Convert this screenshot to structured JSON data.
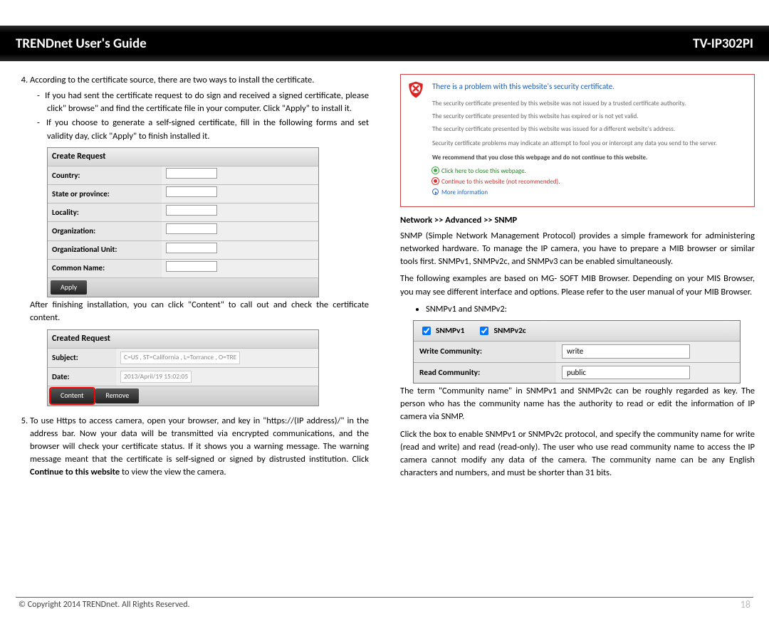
{
  "header": {
    "left": "TRENDnet User's Guide",
    "right": "TV-IP302PI"
  },
  "left": {
    "li4_intro": "According to the certificate source, there are two ways to install the certificate.",
    "dash1": "If you had sent the certificate request to do sign and received a signed certificate, please click\" browse\" and find the certificate file in your computer. Click \"Apply\" to install it.",
    "dash2": "If you choose to generate a self-signed certificate, fill in the following forms and set validity day, click \"Apply\" to finish installed it.",
    "after_install": "After finishing installation, you can click \"Content\" to call out and check the certificate content.",
    "li5_p1": "To use Https to access camera, open your browser, and key in \"https://(IP address)/\" in the address bar. Now your data will be transmitted via encrypted communications, and the browser will check your certificate status. If it shows you a warning message.  The warning message meant that the certificate is self-signed or signed by distrusted institution.  Click ",
    "li5_bold": "Continue to this website",
    "li5_p2": " to view the view the camera.",
    "create_request": {
      "heading": "Create Request",
      "rows": [
        "Country:",
        "State or province:",
        "Locality:",
        "Organization:",
        "Organizational Unit:",
        "Common Name:"
      ],
      "apply": "Apply"
    },
    "created_request": {
      "heading": "Created Request",
      "subject_label": "Subject:",
      "subject_value": "C=US , ST=California , L=Torrance , O=TRE",
      "date_label": "Date:",
      "date_value": "2013/April/19 15:02:05",
      "content": "Content",
      "remove": "Remove"
    }
  },
  "sec": {
    "title": "There is a problem with this website's security certificate.",
    "t1": "The security certificate presented by this website was not issued by a trusted certificate authority.",
    "t2": "The security certificate presented by this website has expired or is not yet valid.",
    "t3": "The security certificate presented by this website was issued for a different website's address.",
    "t4": "Security certificate problems may indicate an attempt to fool you or intercept any data you send to the server.",
    "strong": "We recommend that you close this webpage and do not continue to this website.",
    "link1": "Click here to close this webpage.",
    "link2": "Continue to this website (not recommended).",
    "link3": "More information"
  },
  "right": {
    "heading": "Network >> Advanced >> SNMP",
    "p1": "SNMP (Simple Network Management Protocol) provides a simple framework for administering networked hardware. To manage the IP camera, you have to prepare a MIB browser or similar tools first. SNMPv1, SNMPv2c, and SNMPv3 can be enabled simultaneously.",
    "p2": "The following examples are based on MG- SOFT MIB Browser. Depending on your MIS Browser, you may see different interface and options. Please refer to the user manual of your MIB Browser.",
    "bullet1": "SNMPv1 and SNMPv2:",
    "snmp": {
      "v1": "SNMPv1",
      "v2": "SNMPv2c",
      "write_label": "Write Community:",
      "write_val": "write",
      "read_label": "Read Community:",
      "read_val": "public"
    },
    "p3": "The term \"Community name\" in SNMPv1 and SNMPv2c can be roughly regarded as key. The person who has the community name has the authority to read or edit the information of IP camera via SNMP.",
    "p4": "Click the box to enable SNMPv1 or SNMPv2c protocol, and specify the community name for write (read and write) and read (read-only). The user who use read community name to access the IP camera cannot modify any data of the camera. The community name can be any English characters and numbers, and must be shorter than 31 bits."
  },
  "footer": {
    "copyright": "© Copyright 2014 TRENDnet.  All Rights Reserved.",
    "page": "18"
  }
}
